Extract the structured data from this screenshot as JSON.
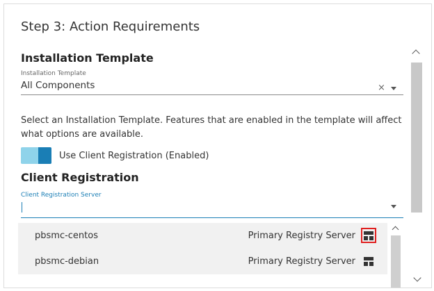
{
  "step": {
    "title": "Step 3: Action Requirements"
  },
  "installation": {
    "heading": "Installation Template",
    "field_label": "Installation Template",
    "value": "All Components",
    "clear_symbol": "×",
    "description": "Select an Installation Template. Features that are enabled in the template will affect what options are available."
  },
  "client_registration": {
    "toggle_label": "Use Client Registration (Enabled)",
    "toggle_on": true,
    "heading": "Client Registration",
    "field_label": "Client Registration Server",
    "value": ""
  },
  "dropdown": {
    "options": [
      {
        "name": "pbsmc-centos",
        "type": "Primary Registry Server",
        "icon": "server-icon",
        "highlighted": true
      },
      {
        "name": "pbsmc-debian",
        "type": "Primary Registry Server",
        "icon": "server-icon",
        "highlighted": false
      }
    ]
  },
  "colors": {
    "accent": "#1a7eb5",
    "toggle_track": "#8fd3ea",
    "highlight": "#e02020",
    "option_bg": "#f1f1f1"
  }
}
